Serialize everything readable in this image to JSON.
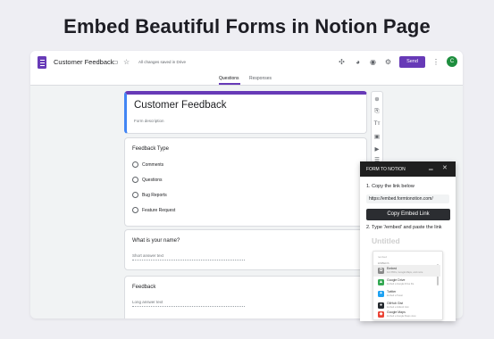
{
  "headline": "Embed Beautiful Forms in Notion Page",
  "topbar": {
    "title": "Customer Feedback",
    "saved_status": "All changes saved in Drive",
    "send_label": "Send",
    "avatar_initial": "C",
    "icons": [
      "folder-icon",
      "star-icon",
      "addon-icon",
      "palette-icon",
      "eye-icon",
      "settings-icon",
      "more-icon"
    ]
  },
  "tabs": [
    "Questions",
    "Responses"
  ],
  "form": {
    "title": "Customer Feedback",
    "description_placeholder": "Form description",
    "questions": [
      {
        "label": "Feedback Type",
        "options": [
          "Comments",
          "Questions",
          "Bug Reports",
          "Feature Request"
        ]
      },
      {
        "label": "What is your name?",
        "answer_placeholder": "Short answer text"
      },
      {
        "label": "Feedback",
        "answer_placeholder": "Long answer text"
      }
    ]
  },
  "side_tools": [
    "add-question-icon",
    "import-icon",
    "title-icon",
    "image-icon",
    "video-icon",
    "section-icon"
  ],
  "extension": {
    "title": "FORM TO NOTION",
    "step1": "1. Copy the link below",
    "link": "https://embed.formtonotion.com/",
    "copy_button": "Copy Embed Link",
    "step2": "2. Type '/embed' and paste the link",
    "preview": {
      "page_title": "Untitled",
      "search_text": "/embed",
      "section_label": "EMBEDS",
      "items": [
        {
          "name": "Embed",
          "sub": "For PDFs, Google Maps, and more",
          "icon": "embed-icon",
          "color": "#8a8a8a"
        },
        {
          "name": "Google Drive",
          "sub": "Embed a Google Drive file",
          "icon": "google-drive-icon",
          "color": "#34a853"
        },
        {
          "name": "Twitter",
          "sub": "Embed a Tweet",
          "icon": "twitter-icon",
          "color": "#1da1f2"
        },
        {
          "name": "GitHub Gist",
          "sub": "Embed a GitHub Gist",
          "icon": "github-icon",
          "color": "#24292e"
        },
        {
          "name": "Google Maps",
          "sub": "Embed a Google Maps view",
          "icon": "google-maps-icon",
          "color": "#ea4335"
        }
      ]
    }
  },
  "colors": {
    "brand": "#673ab7",
    "accent_blue": "#4285f4",
    "ext_header": "#1f1f1f"
  }
}
